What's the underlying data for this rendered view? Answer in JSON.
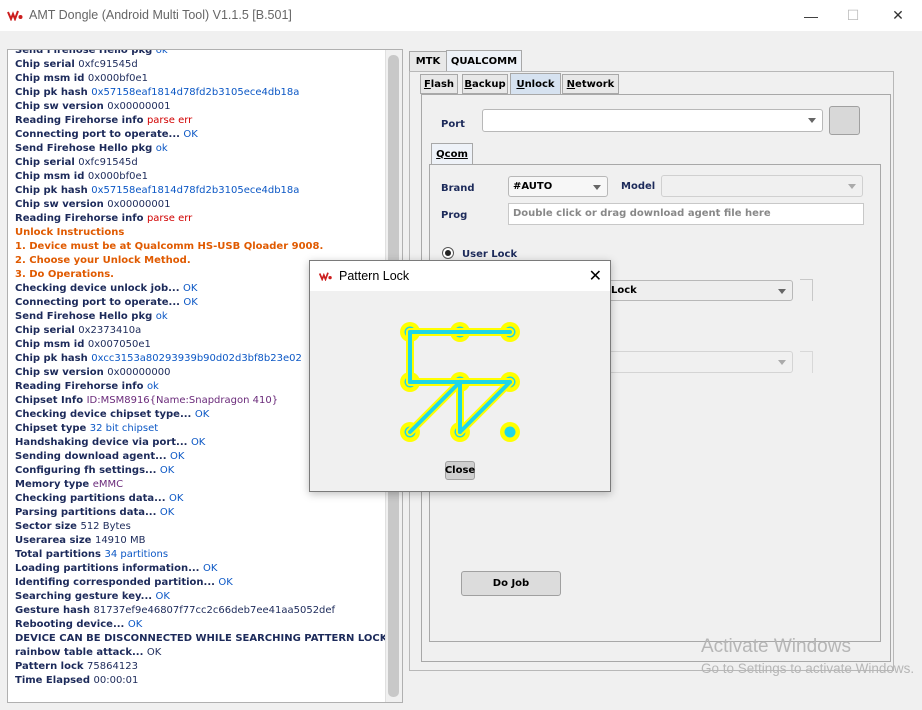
{
  "window": {
    "title": "AMT Dongle (Android Multi Tool) V1.1.5 [B.501]",
    "minimize": "—",
    "maximize": "☐",
    "close": "✕"
  },
  "log": [
    {
      "k": "Send Firehose Hello pkg ",
      "v": "ok",
      "c": "c-blue"
    },
    {
      "k": "Chip serial ",
      "v": "0xfc91545d",
      "c": "c-navy"
    },
    {
      "k": "Chip msm id ",
      "v": "0x000bf0e1",
      "c": "c-navy"
    },
    {
      "k": "Chip pk hash ",
      "v": "0x57158eaf1814d78fd2b3105ece4db18a",
      "c": "c-blue"
    },
    {
      "k": "Chip sw version ",
      "v": "0x00000001",
      "c": "c-navy"
    },
    {
      "k": "Reading Firehorse info  ",
      "v": "parse err",
      "c": "c-red"
    },
    {
      "k": "Connecting port to operate... ",
      "v": "OK",
      "c": "c-blue"
    },
    {
      "k": "Send Firehose Hello pkg ",
      "v": "ok",
      "c": "c-blue"
    },
    {
      "k": "Chip serial ",
      "v": "0xfc91545d",
      "c": "c-navy"
    },
    {
      "k": "Chip msm id ",
      "v": "0x000bf0e1",
      "c": "c-navy"
    },
    {
      "k": "Chip pk hash ",
      "v": "0x57158eaf1814d78fd2b3105ece4db18a",
      "c": "c-blue"
    },
    {
      "k": "Chip sw version ",
      "v": "0x00000001",
      "c": "c-navy"
    },
    {
      "k": "Reading Firehorse info  ",
      "v": "parse err",
      "c": "c-red"
    },
    {
      "k": "Unlock Instructions",
      "v": "",
      "c": "c-orange",
      "kc": "c-orange"
    },
    {
      "k": "1. Device must be at Qualcomm HS-USB Qloader 9008.",
      "v": "",
      "c": "c-orange",
      "kc": "c-orange"
    },
    {
      "k": "2. Choose your Unlock Method.",
      "v": "",
      "c": "c-orange",
      "kc": "c-orange"
    },
    {
      "k": "3. Do Operations.",
      "v": "",
      "c": "c-orange",
      "kc": "c-orange"
    },
    {
      "k": "Checking device unlock job... ",
      "v": "OK",
      "c": "c-blue"
    },
    {
      "k": "Connecting port to operate... ",
      "v": "OK",
      "c": "c-blue"
    },
    {
      "k": "Send Firehose Hello pkg ",
      "v": "ok",
      "c": "c-blue"
    },
    {
      "k": "Chip serial ",
      "v": "0x2373410a",
      "c": "c-navy"
    },
    {
      "k": "Chip msm id ",
      "v": "0x007050e1",
      "c": "c-navy"
    },
    {
      "k": "Chip pk hash ",
      "v": "0xcc3153a80293939b90d02d3bf8b23e02",
      "c": "c-blue"
    },
    {
      "k": "Chip sw version ",
      "v": "0x00000000",
      "c": "c-navy"
    },
    {
      "k": "Reading Firehorse info ",
      "v": "ok",
      "c": "c-blue"
    },
    {
      "k": "Chipset Info ",
      "v": "ID:MSM8916{Name:Snapdragon 410}",
      "c": "c-purple"
    },
    {
      "k": "Checking device chipset type... ",
      "v": "OK",
      "c": "c-blue"
    },
    {
      "k": "Chipset type ",
      "v": "32 bit chipset",
      "c": "c-blue"
    },
    {
      "k": "Handshaking device via port... ",
      "v": "OK",
      "c": "c-blue"
    },
    {
      "k": "Sending download agent... ",
      "v": "OK",
      "c": "c-blue"
    },
    {
      "k": "Configuring fh settings... ",
      "v": "OK",
      "c": "c-blue"
    },
    {
      "k": "Memory type ",
      "v": "eMMC",
      "c": "c-purple"
    },
    {
      "k": "Checking partitions data... ",
      "v": "OK",
      "c": "c-blue"
    },
    {
      "k": "Parsing partitions data... ",
      "v": "OK",
      "c": "c-blue"
    },
    {
      "k": "Sector size ",
      "v": "512 Bytes",
      "c": "c-navy"
    },
    {
      "k": "Userarea size ",
      "v": "14910 MB",
      "c": "c-navy"
    },
    {
      "k": "Total partitions ",
      "v": "34 partitions",
      "c": "c-blue"
    },
    {
      "k": "Loading partitions information... ",
      "v": "OK",
      "c": "c-blue"
    },
    {
      "k": "Identifing corresponded partition... ",
      "v": "OK",
      "c": "c-blue"
    },
    {
      "k": "Searching gesture key... ",
      "v": "OK",
      "c": "c-blue"
    },
    {
      "k": "Gesture hash ",
      "v": "81737ef9e46807f77cc2c66deb7ee41aa5052def",
      "c": "c-navy"
    },
    {
      "k": "Rebooting device... ",
      "v": "OK",
      "c": "c-blue"
    },
    {
      "k": "DEVICE CAN BE DISCONNECTED WHILE SEARCHING PATTERN LOCK.Making",
      "v": "",
      "c": "c-navy"
    },
    {
      "k": "rainbow table attack... ",
      "v": "OK",
      "c": "c-navy"
    },
    {
      "k": "Pattern lock ",
      "v": "75864123",
      "c": "c-navy"
    },
    {
      "k": "Time Elapsed      ",
      "v": "00:00:01",
      "c": "c-navy",
      "kc": "c-navy"
    }
  ],
  "tabs_top": [
    "MTK",
    "QUALCOMM"
  ],
  "tabs_sub": [
    "Flash",
    "Backup",
    "Unlock",
    "Network"
  ],
  "tabs_sub_underline": [
    "F",
    "B",
    "U",
    "N"
  ],
  "port": {
    "label": "Port",
    "value": ""
  },
  "qcom_tab": "Qcom",
  "brand": {
    "label": "Brand",
    "value": "#AUTO"
  },
  "model": {
    "label": "Model",
    "value": ""
  },
  "prog": {
    "label": "Prog",
    "placeholder": "Double click or drag download agent file here"
  },
  "user_lock": "User Lock",
  "lock_combo": "Lock",
  "do_job": "Do Job",
  "dialog": {
    "title": "Pattern Lock",
    "close_button": "Close"
  },
  "pattern": {
    "sequence": [
      7,
      5,
      8,
      6,
      4,
      1,
      2,
      3
    ],
    "dot_color": "#ffff00",
    "line_color": "#1fd6e8"
  },
  "watermark": {
    "line1": "Activate Windows",
    "line2": "Go to Settings to activate Windows."
  }
}
